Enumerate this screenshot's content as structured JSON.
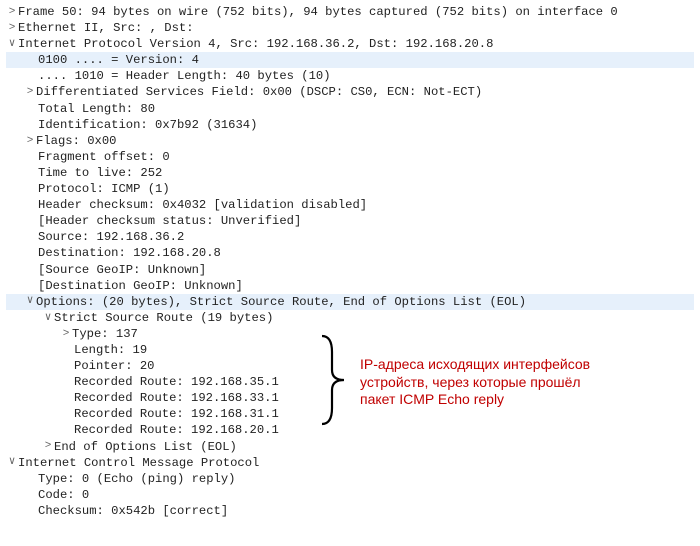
{
  "frame": {
    "line": "Frame 50: 94 bytes on wire (752 bits), 94 bytes captured (752 bits) on interface 0"
  },
  "eth": {
    "line": "Ethernet II, Src:                                         , Dst:"
  },
  "ip": {
    "line": "Internet Protocol Version 4, Src: 192.168.36.2, Dst: 192.168.20.8",
    "version": "0100 .... = Version: 4",
    "hdrlen": ".... 1010 = Header Length: 40 bytes (10)",
    "dsf": "Differentiated Services Field: 0x00 (DSCP: CS0, ECN: Not-ECT)",
    "totlen": "Total Length: 80",
    "ident": "Identification: 0x7b92 (31634)",
    "flags": "Flags: 0x00",
    "fragoff": "Fragment offset: 0",
    "ttl": "Time to live: 252",
    "proto": "Protocol: ICMP (1)",
    "chksum": "Header checksum: 0x4032 [validation disabled]",
    "chkstat": "[Header checksum status: Unverified]",
    "src": "Source: 192.168.36.2",
    "dst": "Destination: 192.168.20.8",
    "srcgeo": "[Source GeoIP: Unknown]",
    "dstgeo": "[Destination GeoIP: Unknown]",
    "options": "Options: (20 bytes), Strict Source Route, End of Options List (EOL)",
    "ssr": "Strict Source Route (19 bytes)",
    "ssr_type": "Type: 137",
    "ssr_len": "Length: 19",
    "ssr_ptr": "Pointer: 20",
    "rr1": "Recorded Route: 192.168.35.1",
    "rr2": "Recorded Route: 192.168.33.1",
    "rr3": "Recorded Route: 192.168.31.1",
    "rr4": "Recorded Route: 192.168.20.1",
    "eol": "End of Options List (EOL)"
  },
  "icmp": {
    "line": "Internet Control Message Protocol",
    "type": "Type: 0 (Echo (ping) reply)",
    "code": "Code: 0",
    "chksum": "Checksum: 0x542b [correct]"
  },
  "annotation": {
    "line1": "IP-адреса исходящих интерфейсов",
    "line2": "устройств, через которые прошёл",
    "line3": "пакет ICMP Echo reply"
  },
  "glyph": {
    "open": "∨",
    "closed": ">"
  }
}
